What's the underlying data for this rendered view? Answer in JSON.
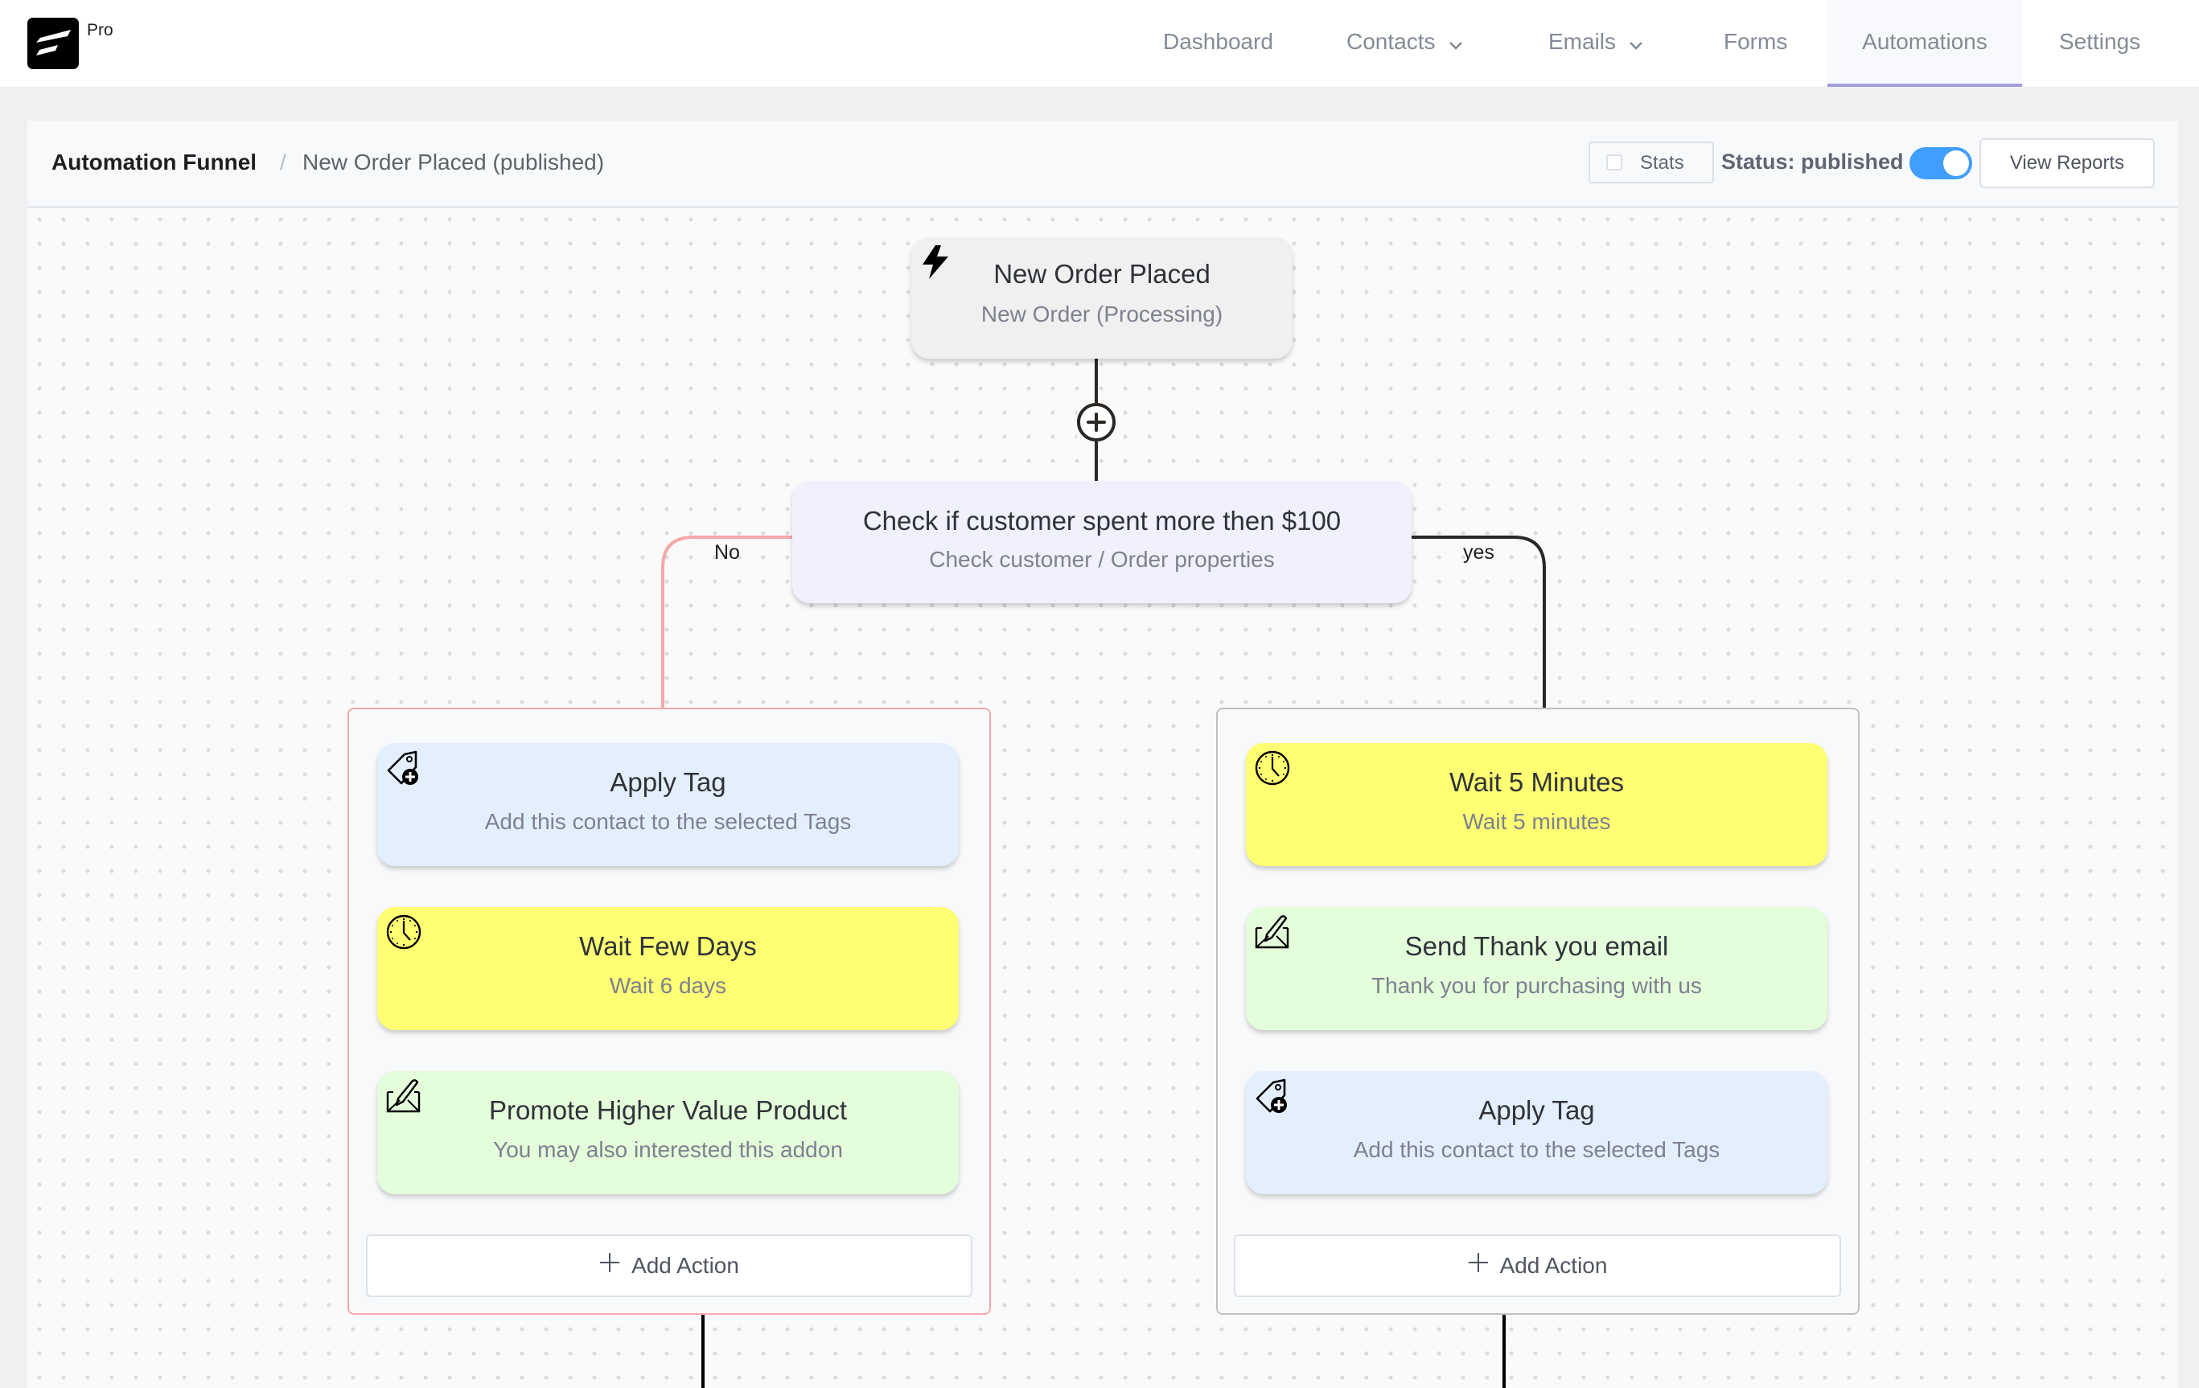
{
  "app": {
    "logo_badge": "Pro",
    "logo_icon": "fluentcrm-logo-icon"
  },
  "nav": {
    "items": [
      {
        "label": "Dashboard",
        "has_dropdown": false,
        "active": false
      },
      {
        "label": "Contacts",
        "has_dropdown": true,
        "active": false
      },
      {
        "label": "Emails",
        "has_dropdown": true,
        "active": false
      },
      {
        "label": "Forms",
        "has_dropdown": false,
        "active": false
      },
      {
        "label": "Automations",
        "has_dropdown": false,
        "active": true
      },
      {
        "label": "Settings",
        "has_dropdown": false,
        "active": false
      }
    ],
    "active_color": "#a29bdb"
  },
  "header": {
    "breadcrumb_root": "Automation Funnel",
    "breadcrumb_separator": "/",
    "breadcrumb_current": "New Order Placed (published)",
    "stats_label": "Stats",
    "stats_checked": false,
    "status_label": "Status: published",
    "status_toggle_on": true,
    "toggle_color": "#409eff",
    "view_reports_label": "View Reports"
  },
  "funnel": {
    "trigger": {
      "icon": "lightning-bolt-icon",
      "title": "New Order Placed",
      "subtitle": "New Order (Processing)"
    },
    "add_step_icon": "plus-circle-icon",
    "condition": {
      "title": "Check if customer spent more then $100",
      "subtitle": "Check customer / Order properties"
    },
    "branches": {
      "no": {
        "label": "No",
        "color": "#f6a8a8",
        "actions": [
          {
            "icon": "tag-plus-icon",
            "title": "Apply Tag",
            "subtitle": "Add this contact to the selected Tags",
            "color": "#e4effd"
          },
          {
            "icon": "clock-icon",
            "title": "Wait Few Days",
            "subtitle": "Wait 6 days",
            "color": "#ffff73"
          },
          {
            "icon": "email-edit-icon",
            "title": "Promote Higher Value Product",
            "subtitle": "You may also interested this addon",
            "color": "#e4fddb"
          }
        ],
        "add_action_label": "Add Action"
      },
      "yes": {
        "label": "yes",
        "color": "#2b2724",
        "actions": [
          {
            "icon": "clock-icon",
            "title": "Wait 5 Minutes",
            "subtitle": "Wait 5 minutes",
            "color": "#ffff73"
          },
          {
            "icon": "email-edit-icon",
            "title": "Send Thank you email",
            "subtitle": "Thank you for purchasing with us",
            "color": "#e4fddb"
          },
          {
            "icon": "tag-plus-icon",
            "title": "Apply Tag",
            "subtitle": "Add this contact to the selected Tags",
            "color": "#e4effd"
          }
        ],
        "add_action_label": "Add Action"
      }
    }
  }
}
